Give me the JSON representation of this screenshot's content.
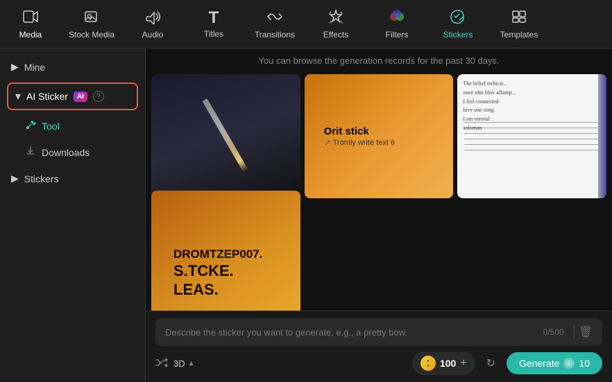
{
  "nav": {
    "items": [
      {
        "id": "media",
        "label": "Media",
        "icon": "🎬",
        "active": false
      },
      {
        "id": "stock-media",
        "label": "Stock Media",
        "icon": "📷",
        "active": false
      },
      {
        "id": "audio",
        "label": "Audio",
        "icon": "🎵",
        "active": false
      },
      {
        "id": "titles",
        "label": "Titles",
        "icon": "T",
        "active": false
      },
      {
        "id": "transitions",
        "label": "Transitions",
        "icon": "↔",
        "active": false
      },
      {
        "id": "effects",
        "label": "Effects",
        "icon": "✨",
        "active": false
      },
      {
        "id": "filters",
        "label": "Filters",
        "icon": "🎨",
        "active": false
      },
      {
        "id": "stickers",
        "label": "Stickers",
        "icon": "💎",
        "active": true
      },
      {
        "id": "templates",
        "label": "Templates",
        "icon": "⊞",
        "active": false
      }
    ]
  },
  "sidebar": {
    "mine_label": "Mine",
    "ai_sticker_label": "AI Sticker",
    "tool_label": "Tool",
    "downloads_label": "Downloads",
    "stickers_label": "Stickers"
  },
  "content": {
    "notice": "You can browse the generation records for the past 30 days.",
    "cards": [
      {
        "id": "card-pencil",
        "type": "pencil"
      },
      {
        "id": "card-orange",
        "type": "orange",
        "title": "Orit stick",
        "subtitle": "Tromly write text 6"
      },
      {
        "id": "card-notebook",
        "type": "notebook"
      },
      {
        "id": "card-big-note",
        "type": "big-note",
        "line1": "DROMTZEP007.",
        "line2": "S.TCKE.",
        "line3": "LEAS."
      }
    ]
  },
  "bottom": {
    "prompt_placeholder": "Describe the sticker you want to generate, e.g., a pretty bow.",
    "char_count": "0/500",
    "style_label": "3D",
    "coin_value": "100",
    "generate_label": "Generate",
    "generate_cost": "10"
  }
}
